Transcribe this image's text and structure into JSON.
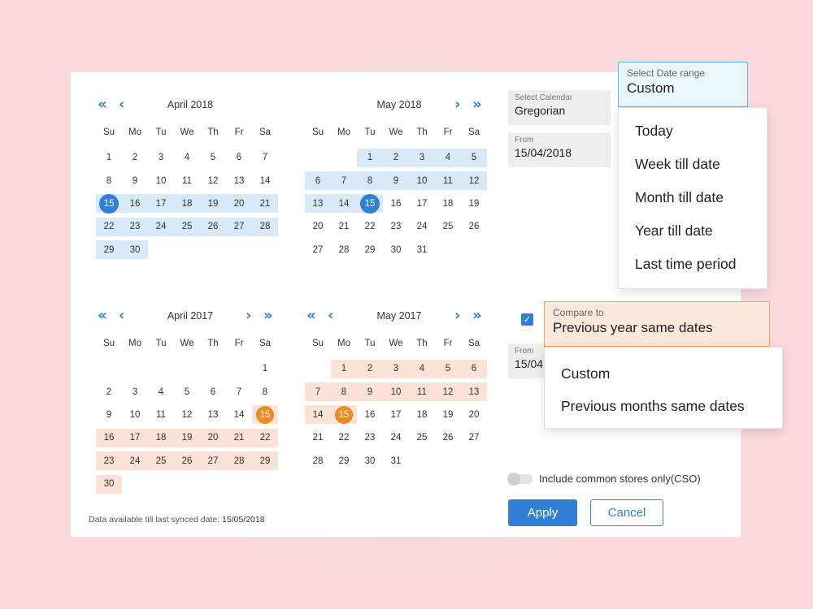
{
  "calendars": [
    {
      "id": "apr2018",
      "title": "April 2018",
      "nav_left": true,
      "nav_right": false,
      "weekdays": [
        "Su",
        "Mo",
        "Tu",
        "We",
        "Th",
        "Fr",
        "Sa"
      ],
      "weeks": [
        [
          {
            "d": "1"
          },
          {
            "d": "2"
          },
          {
            "d": "3"
          },
          {
            "d": "4"
          },
          {
            "d": "5"
          },
          {
            "d": "6"
          },
          {
            "d": "7"
          }
        ],
        [
          {
            "d": "8"
          },
          {
            "d": "9"
          },
          {
            "d": "10"
          },
          {
            "d": "11"
          },
          {
            "d": "12"
          },
          {
            "d": "13"
          },
          {
            "d": "14"
          }
        ],
        [
          {
            "d": "15",
            "h": "blue",
            "sel": "b"
          },
          {
            "d": "16",
            "h": "blue"
          },
          {
            "d": "17",
            "h": "blue"
          },
          {
            "d": "18",
            "h": "blue"
          },
          {
            "d": "19",
            "h": "blue"
          },
          {
            "d": "20",
            "h": "blue"
          },
          {
            "d": "21",
            "h": "blue"
          }
        ],
        [
          {
            "d": "22",
            "h": "blue"
          },
          {
            "d": "23",
            "h": "blue"
          },
          {
            "d": "24",
            "h": "blue"
          },
          {
            "d": "25",
            "h": "blue"
          },
          {
            "d": "26",
            "h": "blue"
          },
          {
            "d": "27",
            "h": "blue"
          },
          {
            "d": "28",
            "h": "blue"
          }
        ],
        [
          {
            "d": "29",
            "h": "blue"
          },
          {
            "d": "30",
            "h": "blue"
          },
          {
            "d": ""
          },
          {
            "d": ""
          },
          {
            "d": ""
          },
          {
            "d": ""
          },
          {
            "d": ""
          }
        ]
      ]
    },
    {
      "id": "may2018",
      "title": "May 2018",
      "nav_left": false,
      "nav_right": true,
      "weekdays": [
        "Su",
        "Mo",
        "Tu",
        "We",
        "Th",
        "Fr",
        "Sa"
      ],
      "weeks": [
        [
          {
            "d": ""
          },
          {
            "d": ""
          },
          {
            "d": "1",
            "h": "blue"
          },
          {
            "d": "2",
            "h": "blue"
          },
          {
            "d": "3",
            "h": "blue"
          },
          {
            "d": "4",
            "h": "blue"
          },
          {
            "d": "5",
            "h": "blue"
          }
        ],
        [
          {
            "d": "6",
            "h": "blue"
          },
          {
            "d": "7",
            "h": "blue"
          },
          {
            "d": "8",
            "h": "blue"
          },
          {
            "d": "9",
            "h": "blue"
          },
          {
            "d": "10",
            "h": "blue"
          },
          {
            "d": "11",
            "h": "blue"
          },
          {
            "d": "12",
            "h": "blue"
          }
        ],
        [
          {
            "d": "13",
            "h": "blue"
          },
          {
            "d": "14",
            "h": "blue"
          },
          {
            "d": "15",
            "h": "blue",
            "sel": "b"
          },
          {
            "d": "16"
          },
          {
            "d": "17"
          },
          {
            "d": "18"
          },
          {
            "d": "19"
          }
        ],
        [
          {
            "d": "20"
          },
          {
            "d": "21"
          },
          {
            "d": "22"
          },
          {
            "d": "23"
          },
          {
            "d": "24"
          },
          {
            "d": "25"
          },
          {
            "d": "26"
          }
        ],
        [
          {
            "d": "27"
          },
          {
            "d": "28"
          },
          {
            "d": "29"
          },
          {
            "d": "30"
          },
          {
            "d": "31"
          },
          {
            "d": ""
          },
          {
            "d": ""
          }
        ]
      ]
    },
    {
      "id": "apr2017",
      "title": "April 2017",
      "nav_left": true,
      "nav_right": true,
      "weekdays": [
        "Su",
        "Mo",
        "Tu",
        "We",
        "Th",
        "Fr",
        "Sa"
      ],
      "weeks": [
        [
          {
            "d": ""
          },
          {
            "d": ""
          },
          {
            "d": ""
          },
          {
            "d": ""
          },
          {
            "d": ""
          },
          {
            "d": ""
          },
          {
            "d": "1"
          }
        ],
        [
          {
            "d": "2"
          },
          {
            "d": "3"
          },
          {
            "d": "4"
          },
          {
            "d": "5"
          },
          {
            "d": "6"
          },
          {
            "d": "7"
          },
          {
            "d": "8"
          }
        ],
        [
          {
            "d": "9"
          },
          {
            "d": "10"
          },
          {
            "d": "11"
          },
          {
            "d": "12"
          },
          {
            "d": "13"
          },
          {
            "d": "14"
          },
          {
            "d": "15",
            "h": "peach",
            "sel": "o"
          }
        ],
        [
          {
            "d": "16",
            "h": "peach"
          },
          {
            "d": "17",
            "h": "peach"
          },
          {
            "d": "18",
            "h": "peach"
          },
          {
            "d": "19",
            "h": "peach"
          },
          {
            "d": "20",
            "h": "peach"
          },
          {
            "d": "21",
            "h": "peach"
          },
          {
            "d": "22",
            "h": "peach"
          }
        ],
        [
          {
            "d": "23",
            "h": "peach"
          },
          {
            "d": "24",
            "h": "peach"
          },
          {
            "d": "25",
            "h": "peach"
          },
          {
            "d": "26",
            "h": "peach"
          },
          {
            "d": "27",
            "h": "peach"
          },
          {
            "d": "28",
            "h": "peach"
          },
          {
            "d": "29",
            "h": "peach"
          }
        ],
        [
          {
            "d": "30",
            "h": "peach"
          },
          {
            "d": ""
          },
          {
            "d": ""
          },
          {
            "d": ""
          },
          {
            "d": ""
          },
          {
            "d": ""
          },
          {
            "d": ""
          }
        ]
      ]
    },
    {
      "id": "may2017",
      "title": "May 2017",
      "nav_left": true,
      "nav_right": true,
      "weekdays": [
        "Su",
        "Mo",
        "Tu",
        "We",
        "Th",
        "Fr",
        "Sa"
      ],
      "weeks": [
        [
          {
            "d": ""
          },
          {
            "d": "1",
            "h": "peach"
          },
          {
            "d": "2",
            "h": "peach"
          },
          {
            "d": "3",
            "h": "peach"
          },
          {
            "d": "4",
            "h": "peach"
          },
          {
            "d": "5",
            "h": "peach"
          },
          {
            "d": "6",
            "h": "peach"
          }
        ],
        [
          {
            "d": "7",
            "h": "peach"
          },
          {
            "d": "8",
            "h": "peach"
          },
          {
            "d": "9",
            "h": "peach"
          },
          {
            "d": "10",
            "h": "peach"
          },
          {
            "d": "11",
            "h": "peach"
          },
          {
            "d": "12",
            "h": "peach"
          },
          {
            "d": "13",
            "h": "peach"
          }
        ],
        [
          {
            "d": "14",
            "h": "peach"
          },
          {
            "d": "15",
            "h": "peach",
            "sel": "o"
          },
          {
            "d": "16"
          },
          {
            "d": "17"
          },
          {
            "d": "18"
          },
          {
            "d": "19"
          },
          {
            "d": "20"
          }
        ],
        [
          {
            "d": "21"
          },
          {
            "d": "22"
          },
          {
            "d": "23"
          },
          {
            "d": "24"
          },
          {
            "d": "25"
          },
          {
            "d": "26"
          },
          {
            "d": "27"
          }
        ],
        [
          {
            "d": "28"
          },
          {
            "d": "29"
          },
          {
            "d": "30"
          },
          {
            "d": "31"
          },
          {
            "d": ""
          },
          {
            "d": ""
          },
          {
            "d": ""
          }
        ]
      ]
    }
  ],
  "nav_icons": {
    "double_left": "«",
    "single_left": "‹",
    "single_right": "›",
    "double_right": "»"
  },
  "select_calendar": {
    "label": "Select Calendar",
    "value": "Gregorian"
  },
  "from_primary": {
    "label": "From",
    "value": "15/04/2018"
  },
  "date_range": {
    "label": "Select Date range",
    "value": "Custom",
    "options": [
      "Today",
      "Week till date",
      "Month till date",
      "Year till date",
      "Last time period"
    ]
  },
  "compare": {
    "checked": true,
    "checkmark": "✓",
    "label": "Compare to",
    "value": "Previous year same dates",
    "options": [
      "Custom",
      "Previous months same dates"
    ]
  },
  "from_compare": {
    "label": "From",
    "value": "15/04"
  },
  "cso": {
    "label": "Include common stores only(CSO)",
    "enabled": false
  },
  "buttons": {
    "apply": "Apply",
    "cancel": "Cancel"
  },
  "footer": {
    "text": "Data available till last synced date: ",
    "date": "15/05/2018"
  },
  "colors": {
    "accent": "#2f80d6",
    "range_current": "#d8eafa",
    "range_compare": "#fbe3d6",
    "selected_current": "#2f80d6",
    "selected_compare": "#ef8a22",
    "date_range_border": "#55b8e8",
    "date_range_bg": "#e9f7fd",
    "compare_border": "#f0a35a",
    "compare_bg": "#fde8dc"
  }
}
